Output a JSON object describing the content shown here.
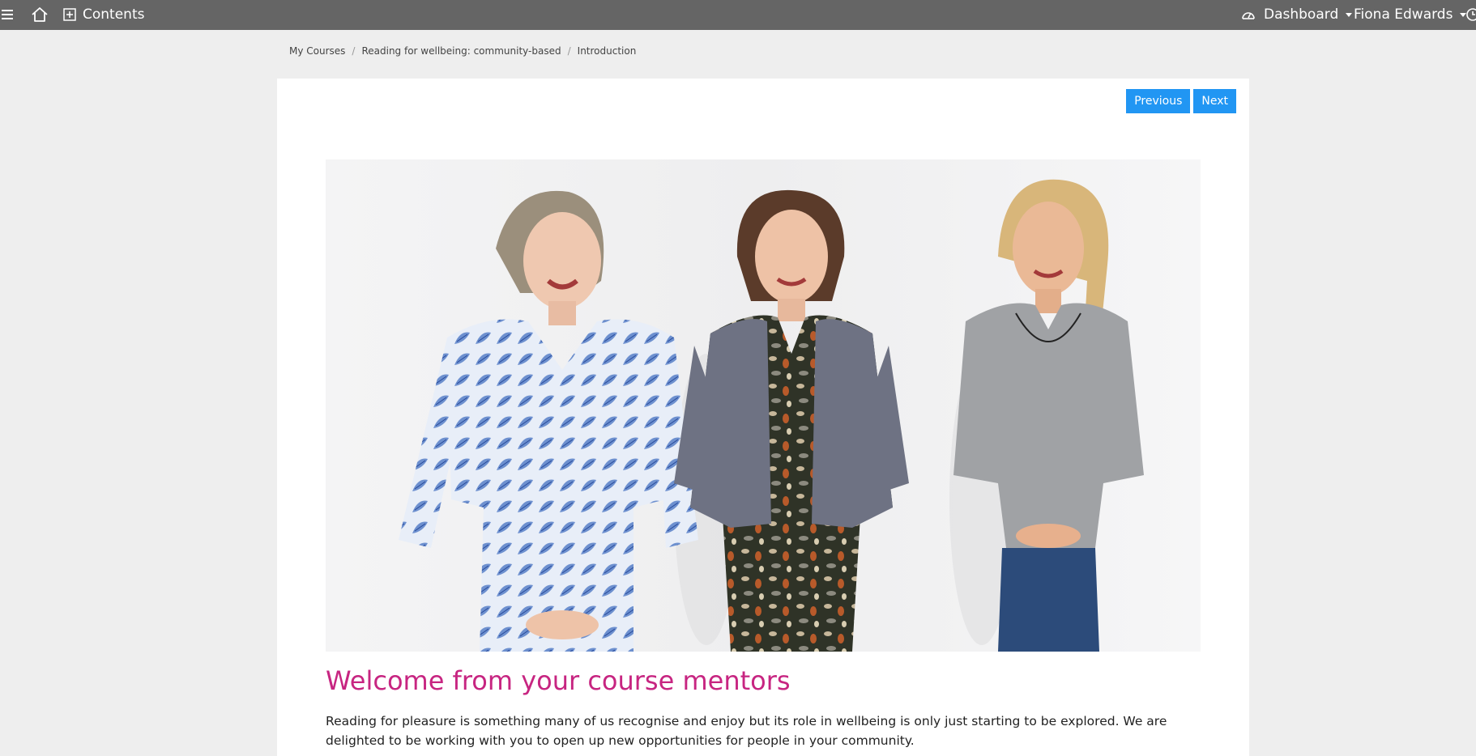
{
  "topbar": {
    "contents_label": "Contents",
    "dashboard_label": "Dashboard",
    "user_name": "Fiona Edwards"
  },
  "breadcrumb": [
    "My Courses",
    "Reading for wellbeing: community-based",
    "Introduction"
  ],
  "nav": {
    "previous_label": "Previous",
    "next_label": "Next"
  },
  "content": {
    "heading": "Welcome from your course mentors",
    "intro": "Reading for pleasure is something many of us recognise and enjoy but its role in wellbeing is only just starting to be explored. We are delighted to be working with you to open up new opportunities for people in your community."
  },
  "colors": {
    "topbar": "#656565",
    "page_bg": "#eeeeee",
    "button": "#2196f3",
    "heading": "#c72581"
  },
  "icons": [
    "menu-icon",
    "home-icon",
    "plus-square-icon",
    "dashboard-gauge-icon",
    "chevron-down-icon",
    "clock-icon"
  ]
}
